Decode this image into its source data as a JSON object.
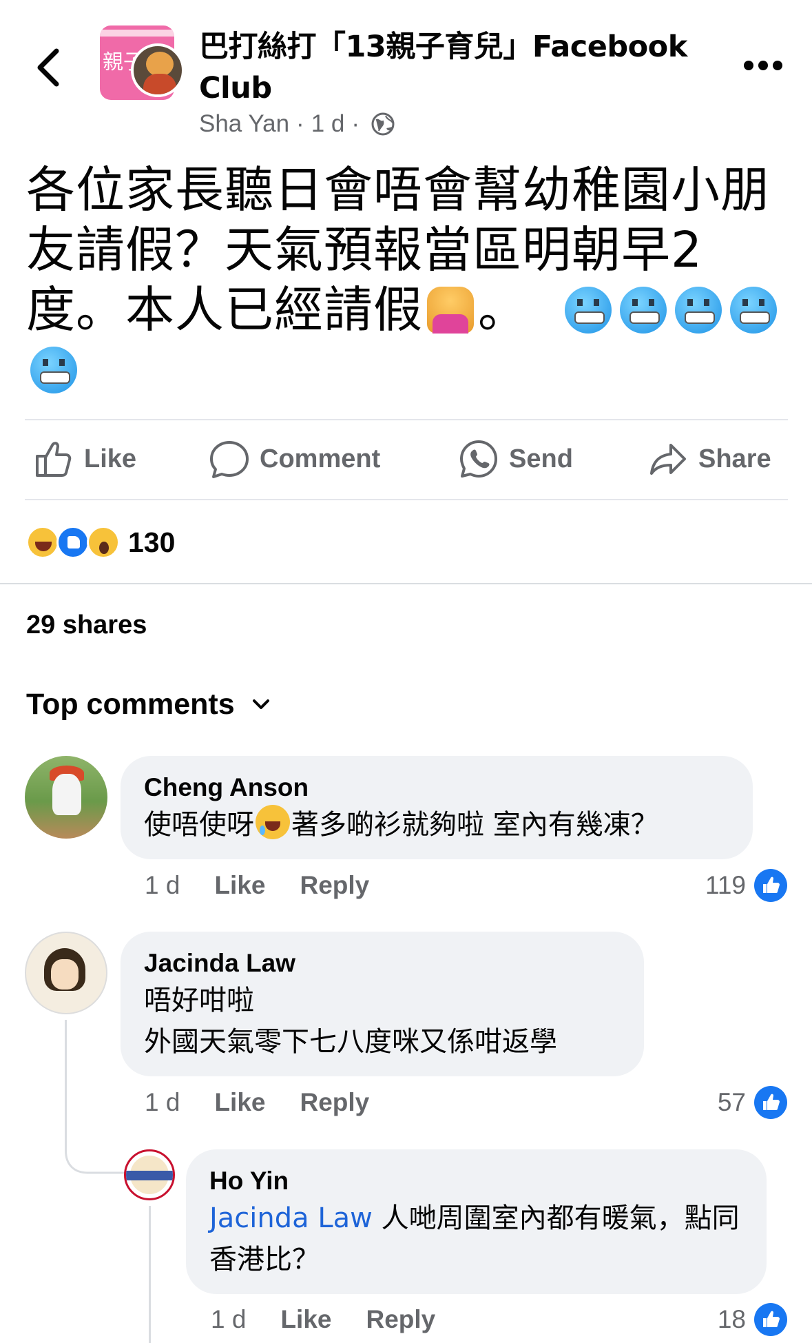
{
  "header": {
    "group_name": "巴打絲打「13親子育兒」Facebook Club",
    "author": "Sha Yan",
    "time": "1 d",
    "separator": "·",
    "avatar_text": "親子"
  },
  "post": {
    "text_part1": "各位家長聽日會唔會幫幼稚園小朋友請假？天氣預報當區明朝早2度。本人已經請假",
    "text_part2": "。",
    "emojis": [
      "raising-hand-emoji",
      "cold-face-emoji"
    ]
  },
  "actions": {
    "like": "Like",
    "comment": "Comment",
    "send": "Send",
    "share": "Share"
  },
  "reactions": {
    "types": [
      "haha",
      "like",
      "wow"
    ],
    "count": "130"
  },
  "shares_label": "29 shares",
  "top_comments_label": "Top comments",
  "comments": [
    {
      "author": "Cheng Anson",
      "text_before": "使唔使呀",
      "text_after": "著多啲衫就夠啦 室內有幾凍？",
      "time": "1 d",
      "like": "Like",
      "reply": "Reply",
      "likes": "119"
    },
    {
      "author": "Jacinda Law",
      "line1": "唔好咁啦",
      "line2": "外國天氣零下七八度咪又係咁返學",
      "time": "1 d",
      "like": "Like",
      "reply": "Reply",
      "likes": "57"
    },
    {
      "author": "Ho Yin",
      "mention": "Jacinda Law",
      "text": " 人哋周圍室內都有暖氣，點同香港比？",
      "time": "1 d",
      "like": "Like",
      "reply": "Reply",
      "likes": "18"
    }
  ],
  "colors": {
    "brand_blue": "#1877f2",
    "mention_blue": "#1e64d8",
    "meta_gray": "#65676b",
    "bubble_bg": "#f0f2f5"
  }
}
